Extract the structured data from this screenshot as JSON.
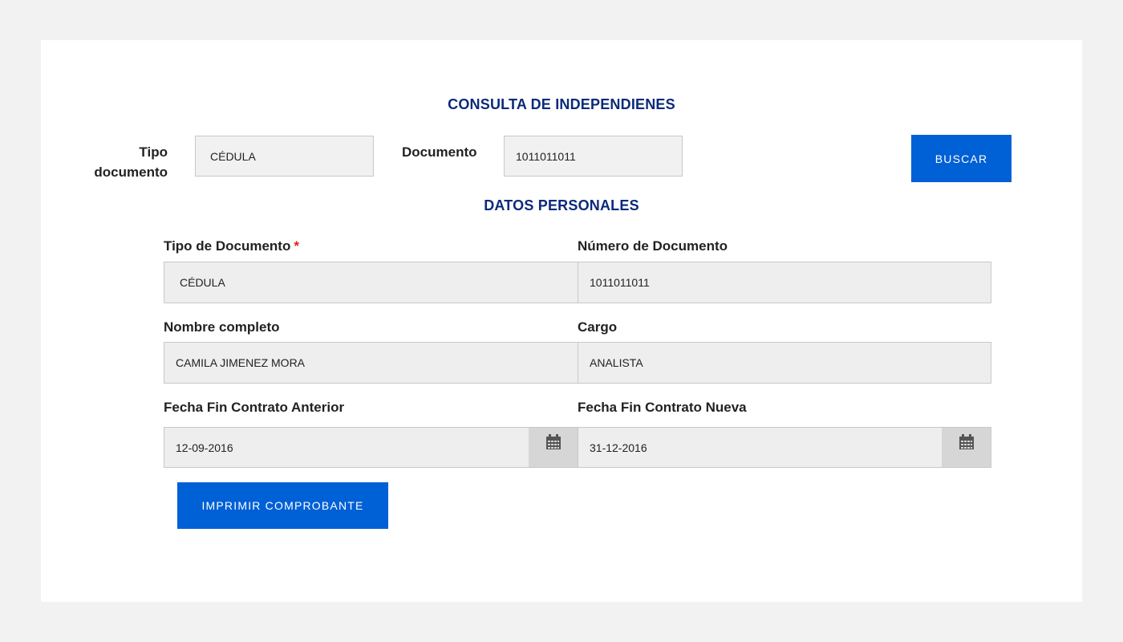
{
  "consulta": {
    "title": "CONSULTA DE INDEPENDIENES",
    "tipo_label_line1": "Tipo",
    "tipo_label_line2": "documento",
    "tipo_value": "CÉDULA",
    "documento_label": "Documento",
    "documento_value": "1011011011",
    "buscar_label": "BUSCAR"
  },
  "datos": {
    "title": "DATOS PERSONALES",
    "tipo_doc_label": "Tipo de Documento",
    "required_mark": "*",
    "tipo_doc_value": "CÉDULA",
    "numero_doc_label": "Número de Documento",
    "numero_doc_value": "1011011011",
    "nombre_label": "Nombre completo",
    "nombre_value": "CAMILA JIMENEZ MORA",
    "cargo_label": "Cargo",
    "cargo_value": "ANALISTA",
    "fecha_anterior_label": "Fecha Fin Contrato Anterior",
    "fecha_anterior_value": "12-09-2016",
    "fecha_nueva_label": "Fecha Fin Contrato Nueva",
    "fecha_nueva_value": "31-12-2016",
    "imprimir_label": "IMPRIMIR COMPROBANTE"
  },
  "icons": {
    "calendar": "calendar-icon"
  },
  "colors": {
    "title": "#0a2a7a",
    "button": "#0060d6",
    "required": "#e02020"
  }
}
